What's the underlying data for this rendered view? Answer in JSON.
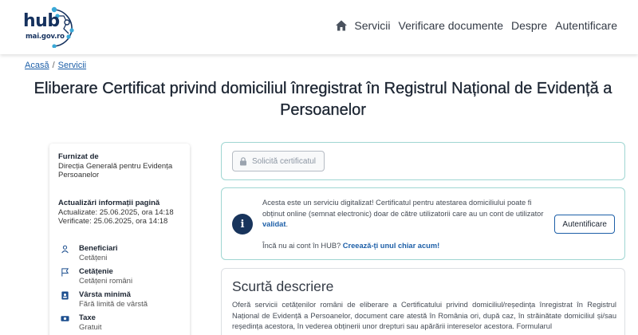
{
  "logo": {
    "word": "hub",
    "domain": "mai.gov.ro"
  },
  "nav": {
    "items": [
      "Servicii",
      "Verificare documente",
      "Despre",
      "Autentificare"
    ]
  },
  "breadcrumb": [
    "Acasă",
    "Servicii"
  ],
  "page_title": "Eliberare Certificat privind domiciliul înregistrat în  Registrul  Național de  Evidență a Persoanelor",
  "info": {
    "provider_label": "Furnizat de",
    "provider_value": "Direcția Generală pentru  Evidența Persoanelor",
    "updates_label": "Actualizări informații pagină",
    "updated_line": "Actualizate: 25.06.2025, ora 14:18",
    "verified_line": "Verificate: 25.06.2025, ora 14:18",
    "rows": [
      {
        "label": "Beneficiari",
        "value": "Cetățeni"
      },
      {
        "label": "Cetățenie",
        "value": "Cetățeni români"
      },
      {
        "label": "Vârsta minimă",
        "value": "Fără limită de vârstă"
      },
      {
        "label": "Taxe",
        "value": "Gratuit"
      }
    ]
  },
  "request_button": "Solicită certificatul",
  "notice": {
    "text_before": "Acesta este un serviciu digitalizat! Certificatul pentru atestarea domiciliului poate fi obținut online (semnat electronic) doar de către utilizatorii care au un cont de utilizator ",
    "text_link": "validat",
    "text_after": ".",
    "question": "Încă nu ai cont în  HUB? ",
    "question_link": "Creează-ți unul chiar acum!",
    "auth_button": "Autentificare"
  },
  "description": {
    "title": "Scurtă descriere",
    "text": "Oferă servicii cetățenilor români de eliberare a Certificatului privind domiciliul/reședința înregistrat în  Registrul  Național de  Evidență a  Persoanelor, document care atestă în  România ori, după caz, în străinătate domiciliul și/sau reședința acestora, în vederea obținerii unor drepturi sau apărării intereselor acestora.  Formularul"
  },
  "colors": {
    "brand": "#15315e",
    "link": "#1d5fa8",
    "panel_border": "#9fd6d2"
  }
}
